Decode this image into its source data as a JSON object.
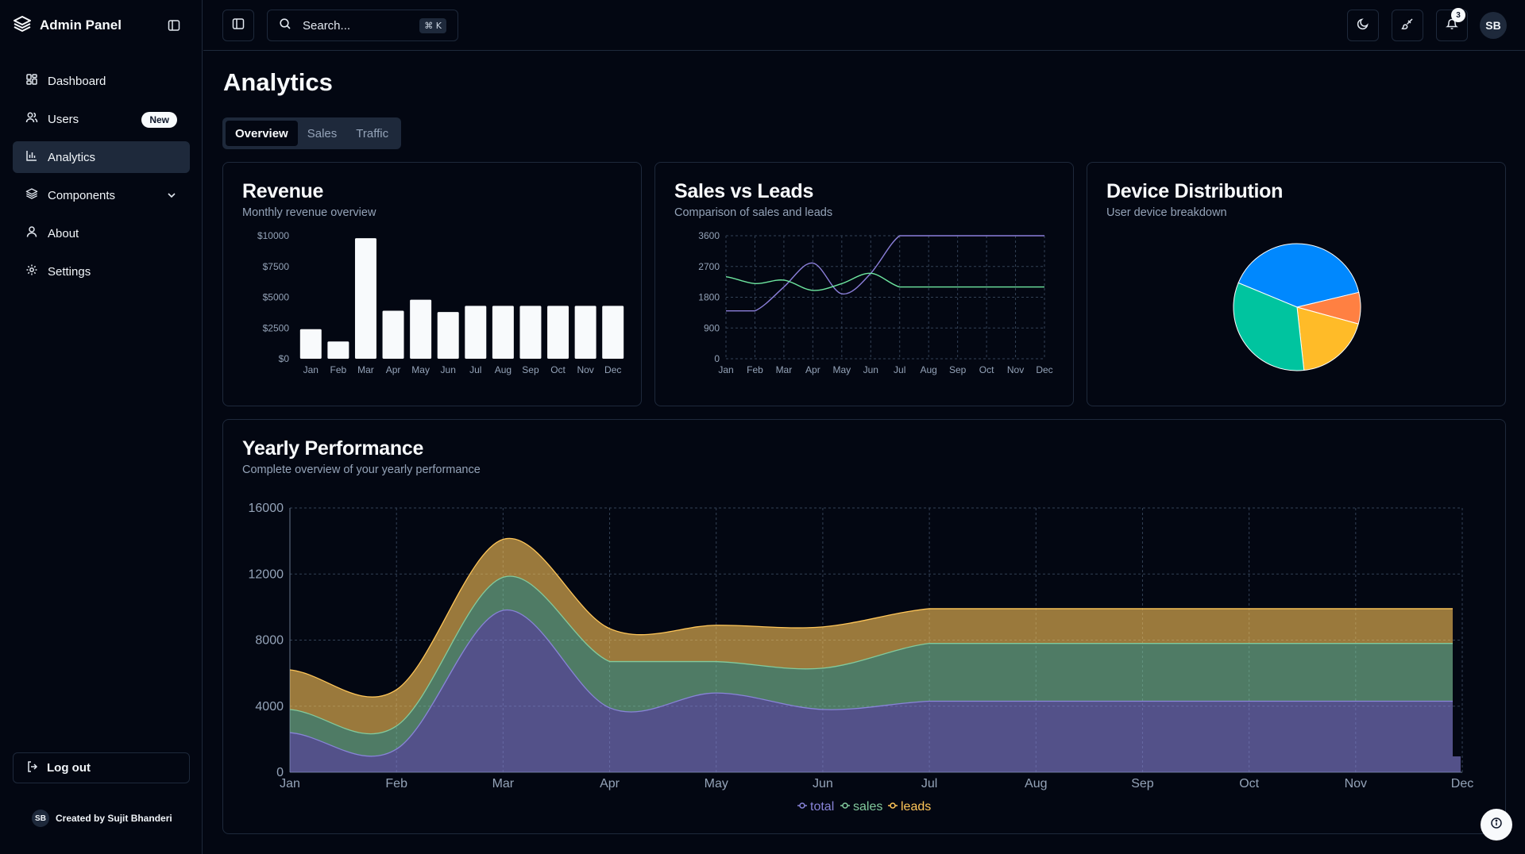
{
  "sidebar": {
    "brand": "Admin Panel",
    "items": [
      {
        "label": "Dashboard",
        "icon": "layout-grid-icon"
      },
      {
        "label": "Users",
        "icon": "users-icon",
        "badge": "New"
      },
      {
        "label": "Analytics",
        "icon": "bar-chart-icon",
        "active": true
      },
      {
        "label": "Components",
        "icon": "layers-icon",
        "expandable": true
      },
      {
        "label": "About",
        "icon": "user-icon"
      },
      {
        "label": "Settings",
        "icon": "gear-icon"
      }
    ],
    "logout_label": "Log out",
    "credit_initials": "SB",
    "credit_text": "Created by Sujit Bhanderi"
  },
  "header": {
    "search_placeholder": "Search...",
    "search_shortcut": "⌘ K",
    "notification_count": "3",
    "avatar_initials": "SB"
  },
  "main": {
    "title": "Analytics",
    "tabs": [
      {
        "label": "Overview",
        "active": true
      },
      {
        "label": "Sales"
      },
      {
        "label": "Traffic"
      }
    ]
  },
  "cards": {
    "revenue": {
      "title": "Revenue",
      "subtitle": "Monthly revenue overview"
    },
    "sales_leads": {
      "title": "Sales vs Leads",
      "subtitle": "Comparison of sales and leads"
    },
    "devices": {
      "title": "Device Distribution",
      "subtitle": "User device breakdown"
    },
    "yearly": {
      "title": "Yearly Performance",
      "subtitle": "Complete overview of your yearly performance"
    }
  },
  "colors": {
    "background": "#030712",
    "border": "#1e293b",
    "muted_text": "#94a3b8",
    "bar": "#f8fafc",
    "sales_line": "#6ee7a0",
    "leads_line": "#8b7fd9",
    "total_area": "#8884d8",
    "sales_area": "#82ca9d",
    "leads_area": "#ffc658",
    "pie_blue": "#0088fe",
    "pie_green": "#00c49f",
    "pie_yellow": "#ffbb28",
    "pie_orange": "#ff8042"
  },
  "chart_data": [
    {
      "id": "revenue",
      "type": "bar",
      "categories": [
        "Jan",
        "Feb",
        "Mar",
        "Apr",
        "May",
        "Jun",
        "Jul",
        "Aug",
        "Sep",
        "Oct",
        "Nov",
        "Dec"
      ],
      "values": [
        2400,
        1400,
        9800,
        3900,
        4800,
        3800,
        4300,
        4300,
        4300,
        4300,
        4300,
        4300
      ],
      "ylim": [
        0,
        10000
      ],
      "yticks": [
        "$0",
        "$2500",
        "$5000",
        "$7500",
        "$10000"
      ],
      "grid": false
    },
    {
      "id": "sales_vs_leads",
      "type": "line",
      "x": [
        "Jan",
        "Feb",
        "Mar",
        "Apr",
        "May",
        "Jun",
        "Jul",
        "Aug",
        "Sep",
        "Oct",
        "Nov",
        "Dec"
      ],
      "series": [
        {
          "values": [
            1400,
            1400,
            2100,
            2800,
            1900,
            2500,
            3600,
            3600,
            3600,
            3600,
            3600,
            3600
          ]
        },
        {
          "values": [
            2400,
            2200,
            2300,
            2000,
            2200,
            2500,
            2100,
            2100,
            2100,
            2100,
            2100,
            2100
          ]
        }
      ],
      "ylim": [
        0,
        3600
      ],
      "yticks": [
        "0",
        "900",
        "1800",
        "2700",
        "3600"
      ],
      "grid": true
    },
    {
      "id": "device_distribution",
      "type": "pie",
      "slices": [
        {
          "value": 40
        },
        {
          "value": 8
        },
        {
          "value": 19
        },
        {
          "value": 33
        }
      ]
    },
    {
      "id": "yearly_performance",
      "type": "area",
      "stacked": true,
      "x": [
        "Jan",
        "Feb",
        "Mar",
        "Apr",
        "May",
        "Jun",
        "Jul",
        "Aug",
        "Sep",
        "Oct",
        "Nov",
        "Dec"
      ],
      "series": [
        {
          "name": "total",
          "values": [
            2400,
            1400,
            9800,
            3900,
            4800,
            3800,
            4300,
            4300,
            4300,
            4300,
            4300,
            4300
          ]
        },
        {
          "name": "sales",
          "values": [
            1400,
            1400,
            2000,
            2800,
            1900,
            2500,
            3500,
            3500,
            3500,
            3500,
            3500,
            3500
          ]
        },
        {
          "name": "leads",
          "values": [
            2400,
            2200,
            2300,
            2000,
            2200,
            2500,
            2100,
            2100,
            2100,
            2100,
            2100,
            2100
          ]
        }
      ],
      "ylim": [
        0,
        16000
      ],
      "yticks": [
        "0",
        "4000",
        "8000",
        "12000",
        "16000"
      ],
      "legend": "bottom-center",
      "grid": true
    }
  ]
}
